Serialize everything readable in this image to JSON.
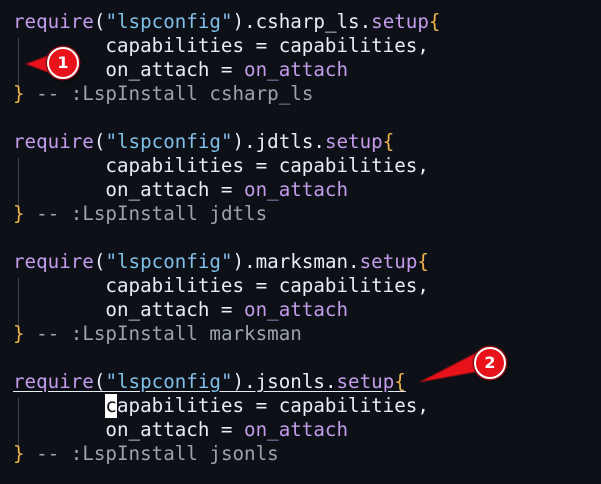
{
  "blocks": [
    {
      "server": "csharp_ls",
      "tail": ".csharp_ls.",
      "comment": "-- :LspInstall csharp_ls"
    },
    {
      "server": "jdtls",
      "tail": ".jdtls.",
      "comment": "-- :LspInstall jdtls"
    },
    {
      "server": "marksman",
      "tail": ".marksman.",
      "comment": "-- :LspInstall marksman"
    },
    {
      "server": "jsonls",
      "tail": ".jsonls.",
      "comment": "-- :LspInstall jsonls"
    }
  ],
  "tokens": {
    "require": "require",
    "open_paren": "(",
    "module": "\"lspconfig\"",
    "close_paren": ")",
    "setup": "setup",
    "open_brace": "{",
    "close_brace": "}",
    "capabilities_line": "        capabilities = capabilities,",
    "cap_indent": "        ",
    "cap_first_char": "c",
    "cap_rest": "apabilities = capabilities,",
    "on_attach_key": "        on_attach = ",
    "on_attach_value": "on_attach"
  },
  "markers": [
    {
      "label": "1"
    },
    {
      "label": "2"
    }
  ],
  "colors": {
    "background": "#0d1117",
    "keyword": "#c49bea",
    "string": "#7fbfe8",
    "brace": "#f0b24a",
    "comment": "#9aa3ad",
    "marker": "#e8121a"
  }
}
